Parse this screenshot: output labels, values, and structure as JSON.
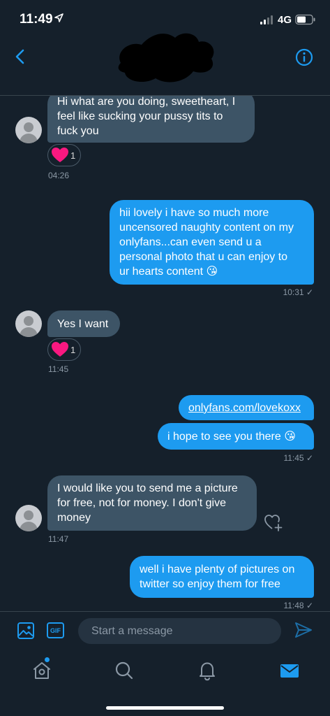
{
  "status_bar": {
    "time": "11:49",
    "network": "4G"
  },
  "header": {
    "back_icon": "chevron-left-icon",
    "info_icon": "info-circle-icon"
  },
  "messages": [
    {
      "direction": "in",
      "lines": [
        "Hi what are you doing, sweetheart, I",
        "feel like sucking your pussy tits to",
        "fuck you"
      ],
      "reaction": {
        "icon": "heart",
        "count": "1"
      },
      "time": "04:26"
    },
    {
      "direction": "out",
      "lines": [
        "hii lovely i have so much more",
        "uncensored naughty content on my",
        "onlyfans...can even send u a",
        "personal photo that u can enjoy to",
        "ur hearts content 😘"
      ],
      "time": "10:31 ✓"
    },
    {
      "direction": "in",
      "lines": [
        "Yes I want"
      ],
      "reaction": {
        "icon": "heart",
        "count": "1"
      },
      "time": "11:45"
    },
    {
      "direction": "out",
      "lines": [
        "onlyfans.com/lovekoxx"
      ],
      "is_link": true
    },
    {
      "direction": "out",
      "lines": [
        "i hope to see you there 😘"
      ],
      "time": "11:45 ✓"
    },
    {
      "direction": "in",
      "lines": [
        "I would like you to send me a picture",
        "for free, not for money. I don't give",
        "money"
      ],
      "time": "11:47"
    },
    {
      "direction": "out",
      "lines": [
        "well i have plenty of pictures on",
        "twitter so enjoy them for free"
      ],
      "time": "11:48 ✓"
    }
  ],
  "composer": {
    "placeholder": "Start a message",
    "gif_label": "GIF"
  },
  "tabbar": {
    "items": [
      "home-icon",
      "search-icon",
      "notifications-icon",
      "messages-icon"
    ],
    "active": "messages-icon"
  },
  "colors": {
    "background": "#15202b",
    "incoming_bubble": "#3d5466",
    "outgoing_bubble": "#1d9bf0",
    "accent": "#1d9bf0",
    "heart": "#f91880"
  }
}
